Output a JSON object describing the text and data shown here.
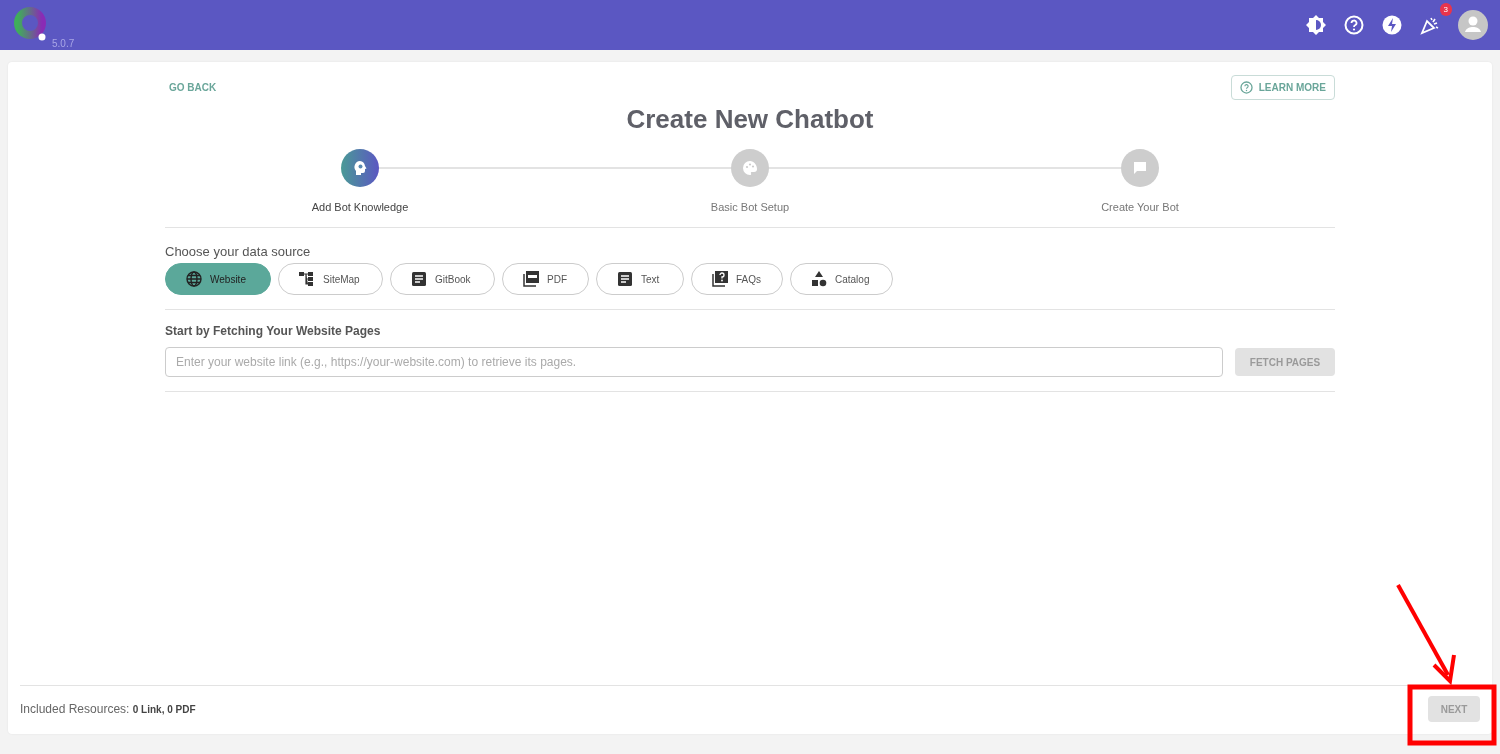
{
  "header": {
    "version": "5.0.7",
    "notification_count": "3"
  },
  "nav": {
    "back": "GO BACK",
    "learn_more": "LEARN MORE"
  },
  "title": "Create New Chatbot",
  "steps": [
    {
      "label": "Add Bot Knowledge",
      "kind": "knowledge",
      "active": true
    },
    {
      "label": "Basic Bot Setup",
      "kind": "palette",
      "active": false
    },
    {
      "label": "Create Your Bot",
      "kind": "chat",
      "active": false
    }
  ],
  "source_label": "Choose your data source",
  "sources": [
    {
      "label": "Website",
      "kind": "globe",
      "selected": true
    },
    {
      "label": "SiteMap",
      "kind": "sitemap",
      "selected": false
    },
    {
      "label": "GitBook",
      "kind": "doc",
      "selected": false
    },
    {
      "label": "PDF",
      "kind": "pdf",
      "selected": false
    },
    {
      "label": "Text",
      "kind": "doc",
      "selected": false
    },
    {
      "label": "FAQs",
      "kind": "faq",
      "selected": false
    },
    {
      "label": "Catalog",
      "kind": "shapes",
      "selected": false
    }
  ],
  "fetch": {
    "heading": "Start by Fetching Your Website Pages",
    "placeholder": "Enter your website link (e.g., https://your-website.com) to retrieve its pages.",
    "button": "FETCH PAGES",
    "disabled": true
  },
  "footer": {
    "label": "Included Resources:",
    "value": "0 Link, 0 PDF",
    "next": "NEXT",
    "next_disabled": true
  }
}
